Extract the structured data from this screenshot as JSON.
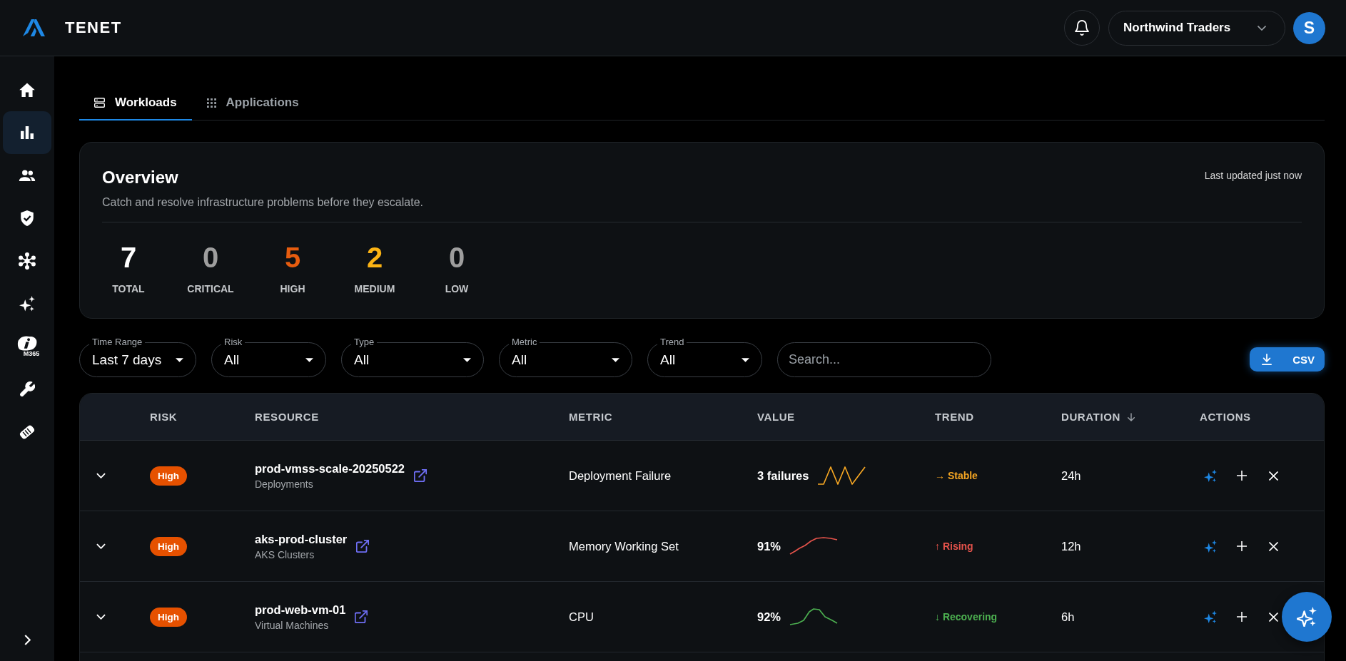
{
  "header": {
    "brand": "TENET",
    "organization": "Northwind Traders",
    "avatar_initial": "S"
  },
  "sidebar": {
    "items": [
      {
        "selected": false
      },
      {
        "selected": true
      },
      {
        "selected": false
      },
      {
        "selected": false
      },
      {
        "selected": false
      },
      {
        "selected": false
      },
      {
        "selected": false,
        "caption": "M365"
      },
      {
        "selected": false
      },
      {
        "selected": false
      }
    ]
  },
  "tabs": [
    {
      "label": "Workloads",
      "selected": true
    },
    {
      "label": "Applications",
      "selected": false
    }
  ],
  "overview": {
    "title": "Overview",
    "subtitle": "Catch and resolve infrastructure problems before they escalate.",
    "updated": "Last updated just now",
    "stats": [
      {
        "value": "7",
        "label": "TOTAL",
        "color": "#ffffff"
      },
      {
        "value": "0",
        "label": "CRITICAL",
        "color": "#9e9e9e"
      },
      {
        "value": "5",
        "label": "HIGH",
        "color": "#e65c0f"
      },
      {
        "value": "2",
        "label": "MEDIUM",
        "color": "#fbb314"
      },
      {
        "value": "0",
        "label": "LOW",
        "color": "#9e9e9e"
      }
    ]
  },
  "filters": [
    {
      "label": "Time Range",
      "value": "Last 7 days"
    },
    {
      "label": "Risk",
      "value": "All"
    },
    {
      "label": "Type",
      "value": "All"
    },
    {
      "label": "Metric",
      "value": "All"
    },
    {
      "label": "Trend",
      "value": "All"
    }
  ],
  "search": {
    "placeholder": "Search..."
  },
  "export_button": {
    "label": "CSV"
  },
  "table": {
    "columns": [
      {
        "label": "RISK",
        "sorted": false
      },
      {
        "label": "RESOURCE",
        "sorted": false
      },
      {
        "label": "METRIC",
        "sorted": false
      },
      {
        "label": "VALUE",
        "sorted": false
      },
      {
        "label": "TREND",
        "sorted": false
      },
      {
        "label": "DURATION",
        "sorted": true
      },
      {
        "label": "ACTIONS",
        "sorted": false
      }
    ],
    "rows": [
      {
        "risk": {
          "label": "High",
          "color": "#e65100"
        },
        "resource": "prod-vmss-scale-20250522",
        "resource_type": "Deployments",
        "metric": "Deployment Failure",
        "value": "3 failures",
        "trend": {
          "label": "→ Stable",
          "color": "#f5a623"
        },
        "duration": "24h"
      },
      {
        "risk": {
          "label": "High",
          "color": "#e65100"
        },
        "resource": "aks-prod-cluster",
        "resource_type": "AKS Clusters",
        "metric": "Memory Working Set",
        "value": "91%",
        "trend": {
          "label": "↑ Rising",
          "color": "#e5534b"
        },
        "duration": "12h"
      },
      {
        "risk": {
          "label": "High",
          "color": "#e65100"
        },
        "resource": "prod-web-vm-01",
        "resource_type": "Virtual Machines",
        "metric": "CPU",
        "value": "92%",
        "trend": {
          "label": "↓ Recovering",
          "color": "#4caf50"
        },
        "duration": "6h"
      }
    ]
  }
}
